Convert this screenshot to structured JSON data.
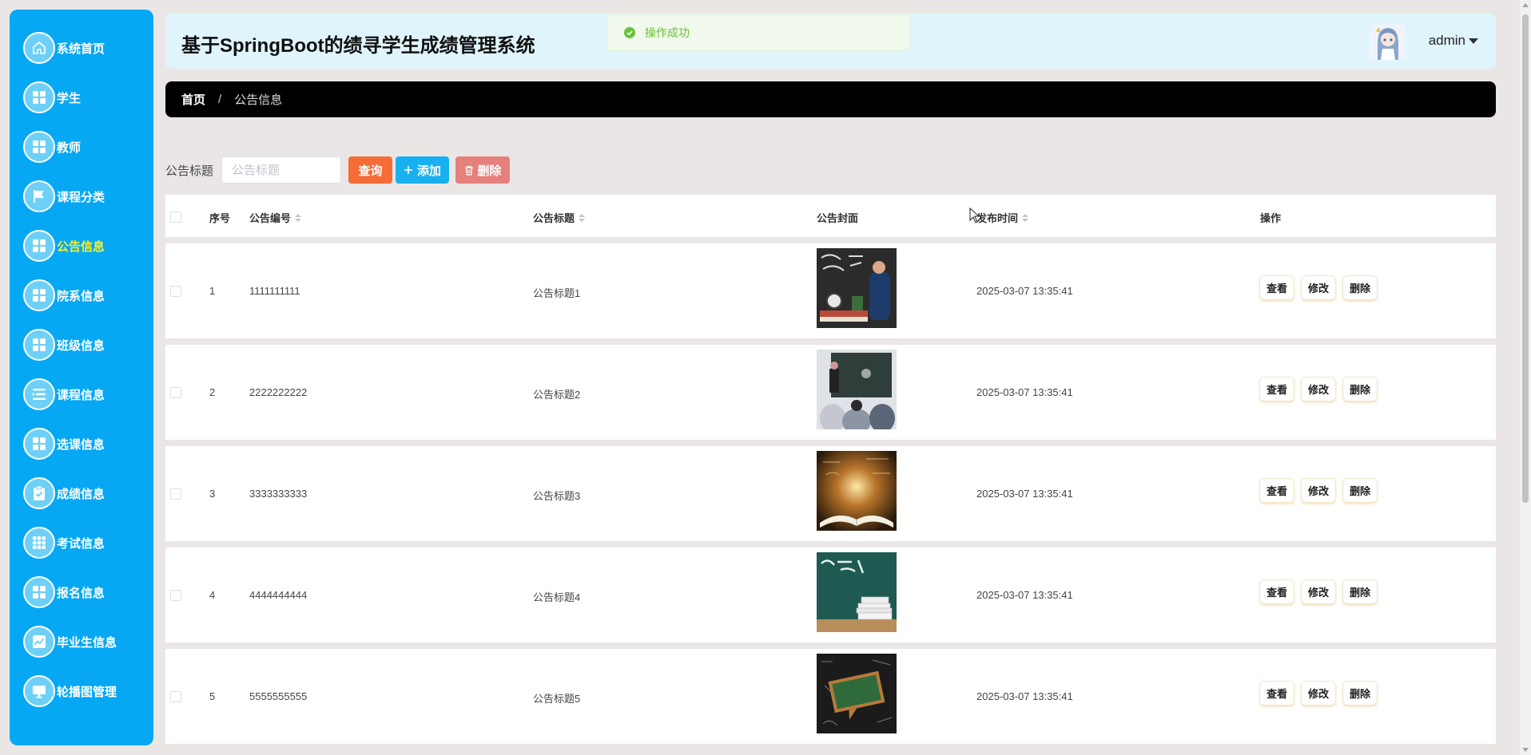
{
  "app": {
    "title": "基于SpringBoot的绩寻学生成绩管理系统",
    "user": "admin"
  },
  "toast": {
    "message": "操作成功"
  },
  "sidebar": {
    "items": [
      {
        "label": "系统首页",
        "icon": "home-icon"
      },
      {
        "label": "学生",
        "icon": "grid-icon"
      },
      {
        "label": "教师",
        "icon": "grid-icon"
      },
      {
        "label": "课程分类",
        "icon": "flag-icon"
      },
      {
        "label": "公告信息",
        "icon": "grid-icon",
        "active": true
      },
      {
        "label": "院系信息",
        "icon": "grid-icon"
      },
      {
        "label": "班级信息",
        "icon": "grid-icon"
      },
      {
        "label": "课程信息",
        "icon": "list-icon"
      },
      {
        "label": "选课信息",
        "icon": "grid-icon"
      },
      {
        "label": "成绩信息",
        "icon": "clipboard-check-icon"
      },
      {
        "label": "考试信息",
        "icon": "apps-icon"
      },
      {
        "label": "报名信息",
        "icon": "grid-icon"
      },
      {
        "label": "毕业生信息",
        "icon": "chart-icon"
      },
      {
        "label": "轮播图管理",
        "icon": "monitor-icon"
      }
    ],
    "active_color": "#f7ef2a",
    "background": "#06a8f4"
  },
  "breadcrumb": {
    "home": "首页",
    "separator": "/",
    "current": "公告信息"
  },
  "search": {
    "label": "公告标题",
    "placeholder": "公告标题",
    "query_label": "查询",
    "add_label": "添加",
    "delete_label": "删除"
  },
  "table": {
    "columns": {
      "index": "序号",
      "code": "公告编号",
      "title": "公告标题",
      "cover": "公告封面",
      "time": "发布时间",
      "ops": "操作"
    },
    "rows": [
      {
        "index": "1",
        "code": "1111111111",
        "title": "公告标题1",
        "time": "2025-03-07 13:35:41"
      },
      {
        "index": "2",
        "code": "2222222222",
        "title": "公告标题2",
        "time": "2025-03-07 13:35:41"
      },
      {
        "index": "3",
        "code": "3333333333",
        "title": "公告标题3",
        "time": "2025-03-07 13:35:41"
      },
      {
        "index": "4",
        "code": "4444444444",
        "title": "公告标题4",
        "time": "2025-03-07 13:35:41"
      },
      {
        "index": "5",
        "code": "5555555555",
        "title": "公告标题5",
        "time": "2025-03-07 13:35:41"
      }
    ],
    "actions": {
      "view": "查看",
      "edit": "修改",
      "delete": "删除"
    }
  },
  "colors": {
    "query_button": "#f56c37",
    "add_button": "#18b0f0",
    "delete_button": "#e5807d",
    "toast_text": "#67c23a"
  }
}
